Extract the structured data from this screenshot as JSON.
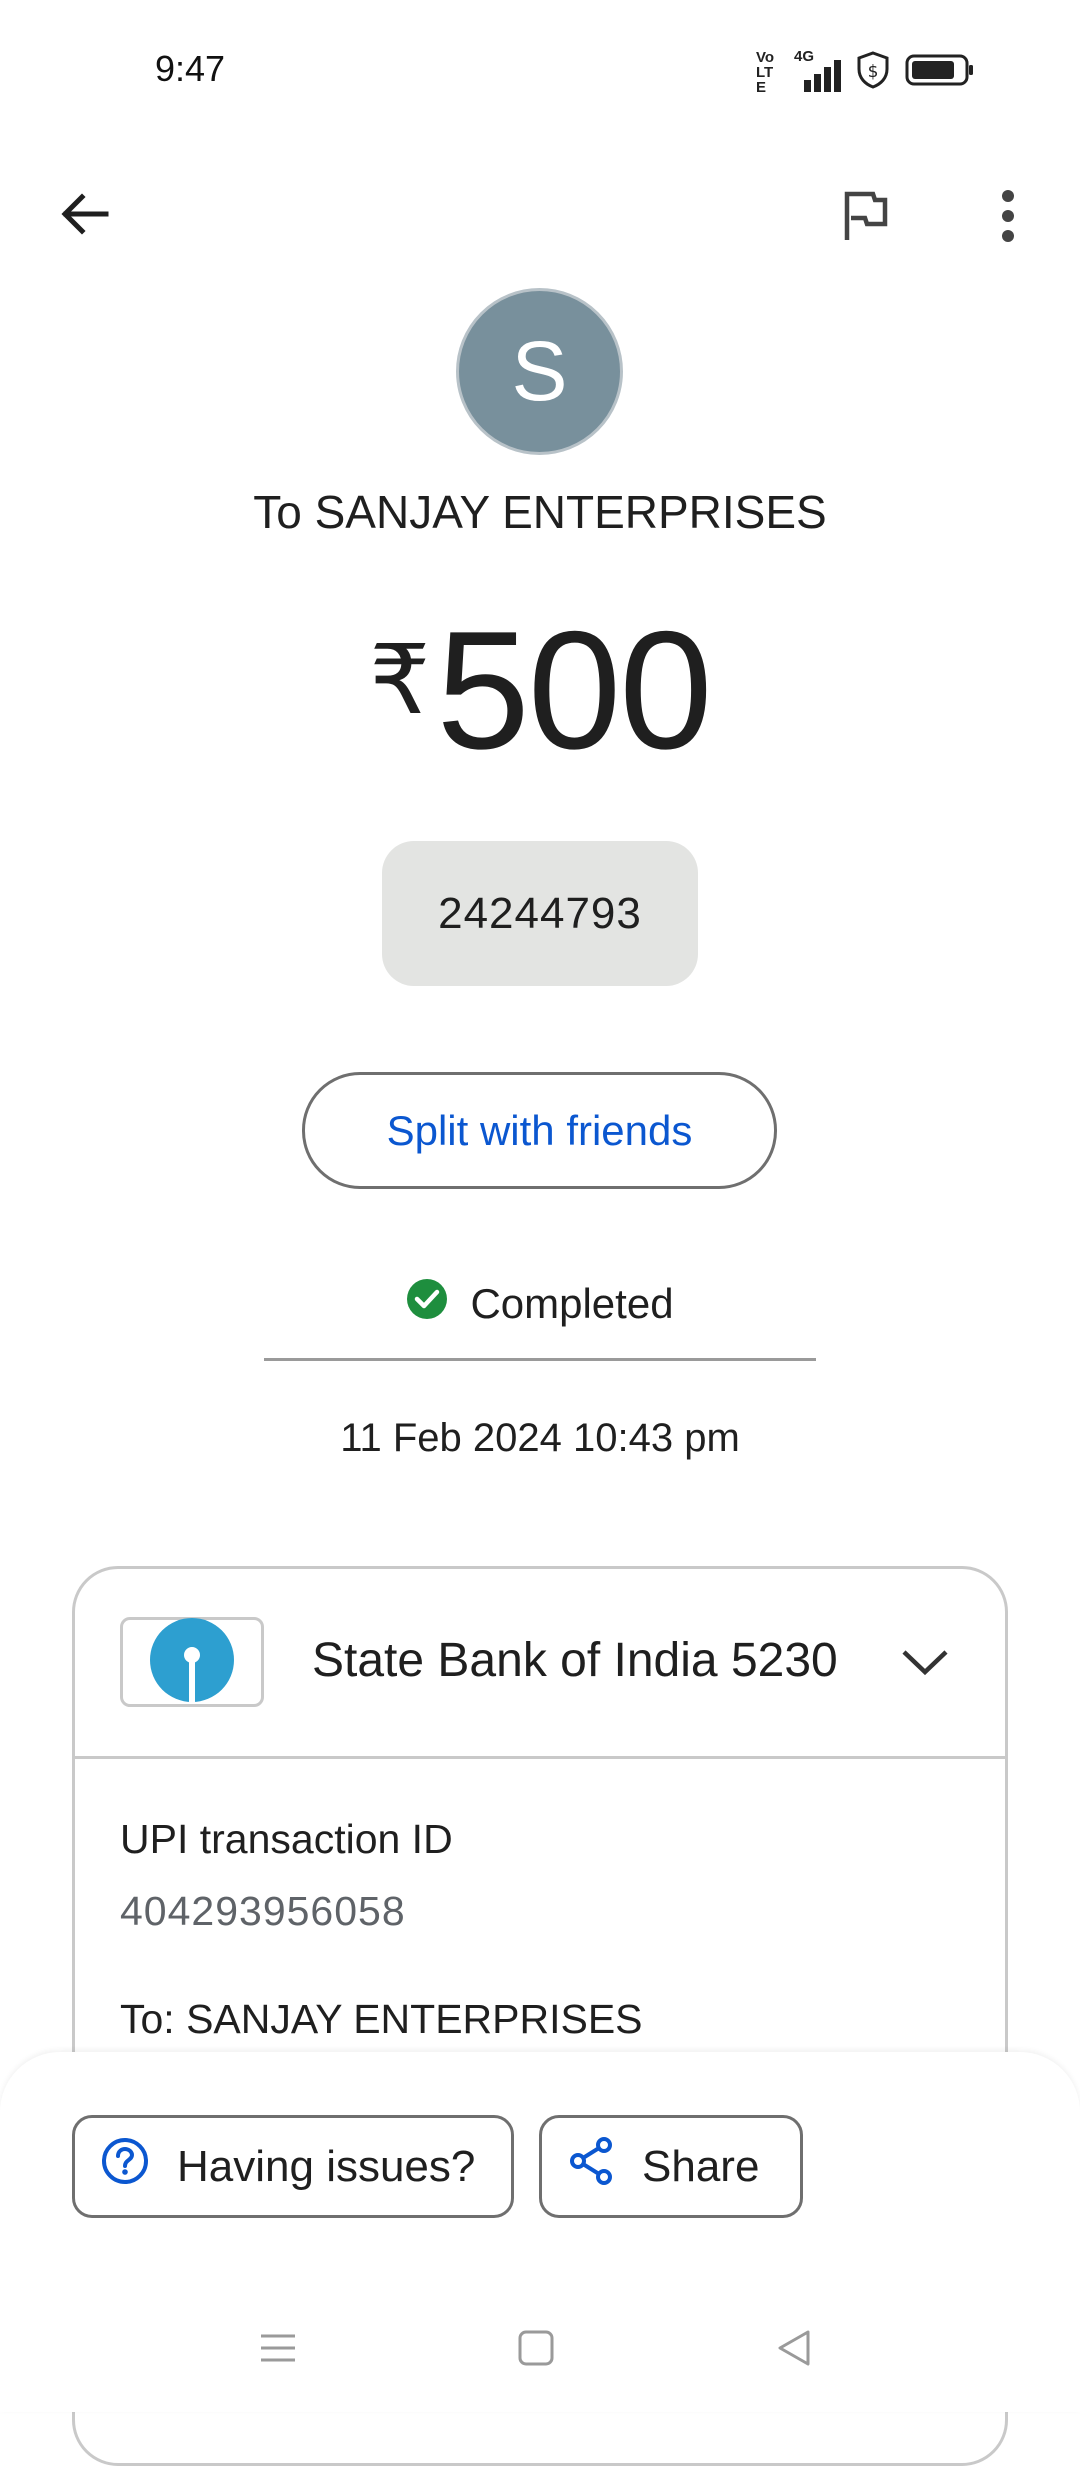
{
  "status_bar": {
    "time": "9:47",
    "network_label": "Vo LTE",
    "signal_label": "4G",
    "icons": [
      "volte-icon",
      "signal-4g-icon",
      "shield-dollar-icon",
      "battery-icon"
    ]
  },
  "header": {
    "back_icon": "arrow-left-icon",
    "report_icon": "flag-icon",
    "more_icon": "more-vertical-icon"
  },
  "payee": {
    "avatar_initial": "S",
    "avatar_color": "#78909c",
    "title": "To SANJAY ENTERPRISES"
  },
  "payment": {
    "currency_symbol": "₹",
    "amount": "500",
    "note": "24244793"
  },
  "actions": {
    "split_label": "Split with friends"
  },
  "status": {
    "label": "Completed",
    "color": "#1e8e3e",
    "datetime": "11 Feb 2024 10:43 pm"
  },
  "details": {
    "bank_name": "State Bank of India 5230",
    "bank_logo_color": "#2d9fd0",
    "upi_label": "UPI transaction ID",
    "upi_value": "404293956058",
    "to_line": "To: SANJAY ENTERPRISES"
  },
  "bottom_actions": {
    "issues_label": "Having issues?",
    "share_label": "Share",
    "accent": "#0b57d0"
  },
  "nav_bar": {
    "icons": [
      "menu-icon",
      "home-square-icon",
      "back-triangle-icon"
    ]
  }
}
